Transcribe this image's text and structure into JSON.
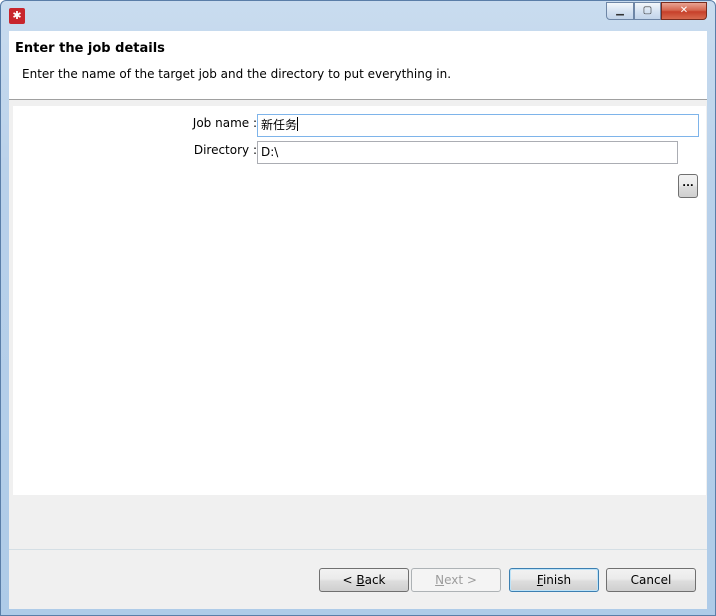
{
  "window": {
    "icon": "app-logo-icon",
    "controls": {
      "minimize": "minimize-icon",
      "maximize": "maximize-icon",
      "close": "close-icon"
    }
  },
  "header": {
    "title": "Enter the job details",
    "description": "Enter the name of the target job and the directory to put everything in."
  },
  "form": {
    "job_name_label": "Job name :",
    "job_name_value": "新任务",
    "directory_label": "Directory :",
    "directory_value": "D:\\",
    "browse_label": "..."
  },
  "buttons": {
    "back": {
      "prefix": "< ",
      "mnemonic": "B",
      "rest": "ack"
    },
    "next": {
      "mnemonic": "N",
      "rest": "ext >"
    },
    "finish": {
      "mnemonic": "F",
      "rest": "inish"
    },
    "cancel": "Cancel"
  },
  "colors": {
    "close_button": "#c7402a",
    "header_bg": "#ffffff",
    "content_bg": "#f0f0f0"
  }
}
